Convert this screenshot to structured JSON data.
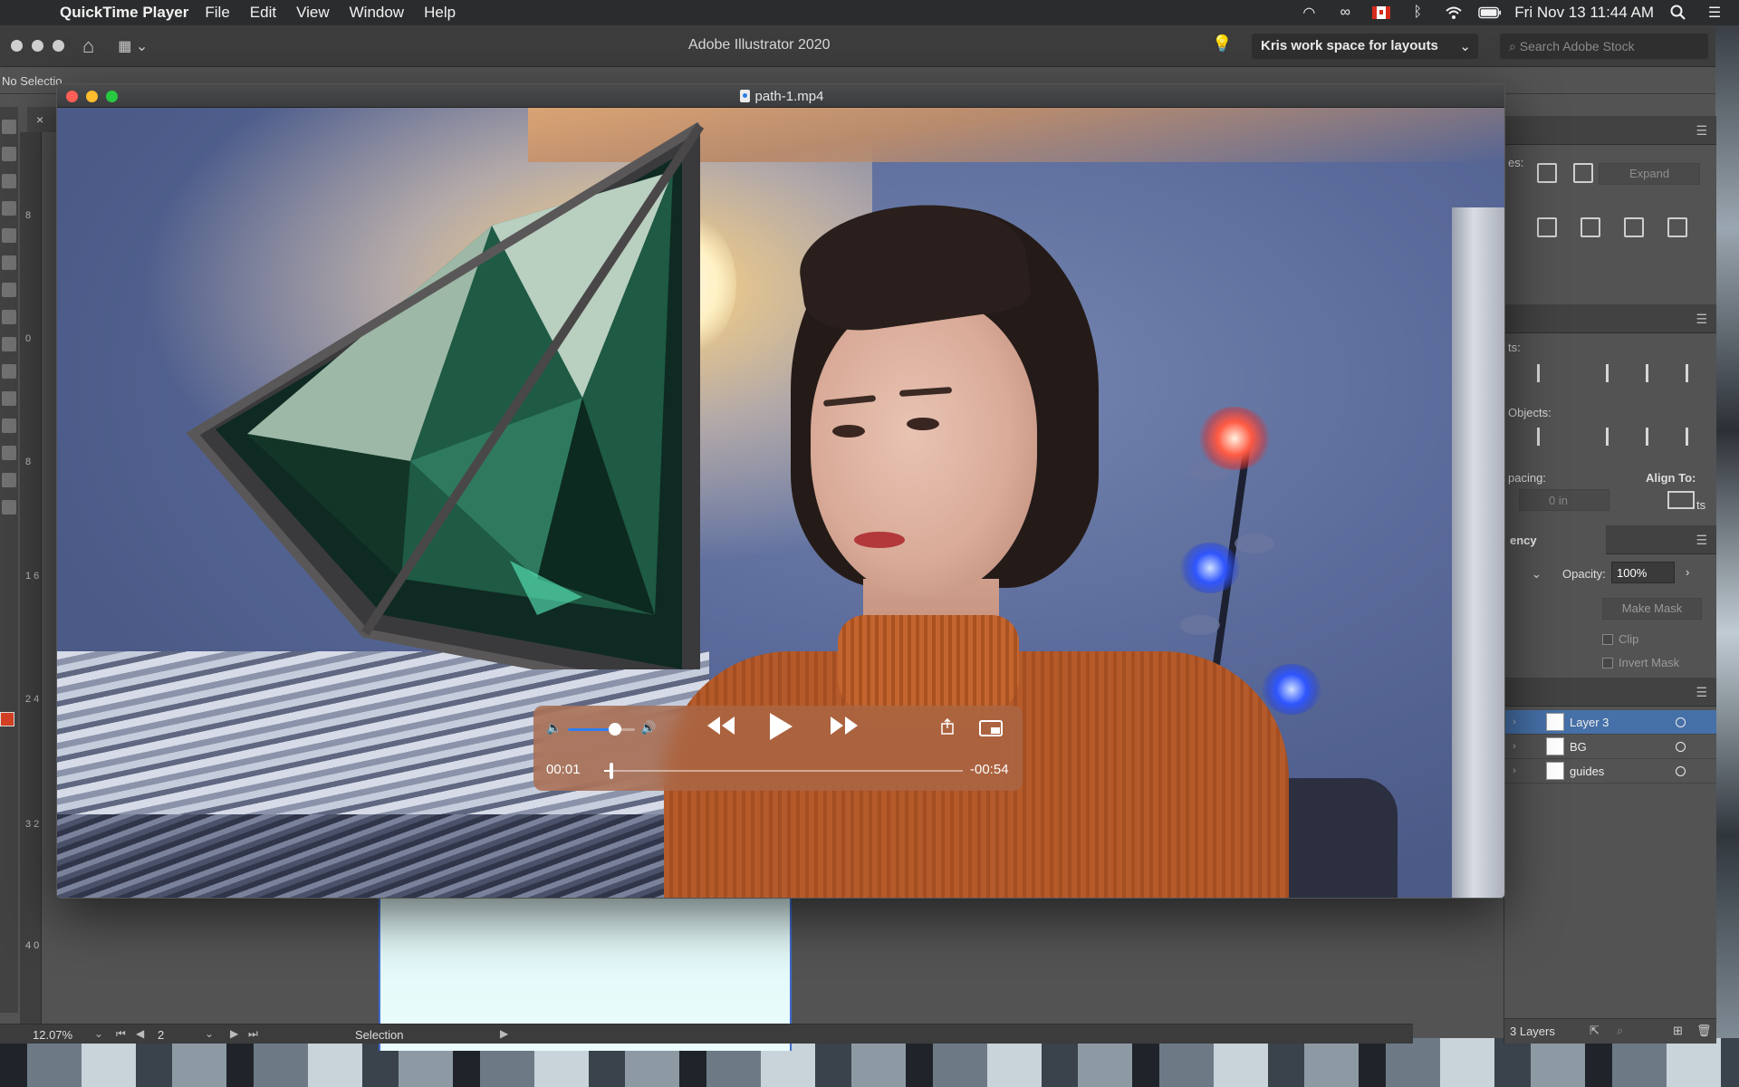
{
  "menubar": {
    "app_name": "QuickTime Player",
    "items": [
      "File",
      "Edit",
      "View",
      "Window",
      "Help"
    ],
    "datetime": "Fri Nov 13  11:44 AM"
  },
  "illustrator": {
    "title": "Adobe Illustrator 2020",
    "workspace": "Kris work space for layouts",
    "search_placeholder": "Search Adobe Stock",
    "control_bar_label": "No Selectio",
    "doc_tab_close": "×",
    "ruler_marks": [
      "8",
      "0",
      "8",
      "1 6",
      "2 4",
      "3 2",
      "4 0"
    ],
    "status": {
      "zoom": "12.07%",
      "page": "2",
      "tool": "Selection"
    },
    "pathfinder": {
      "shape_modes_label": "es:",
      "expand_label": "Expand"
    },
    "align": {
      "objects_label": "ts:",
      "distribute_label": "Objects:",
      "spacing_label": "pacing:",
      "align_to_label": "Align To:",
      "spacing_value": "0 in",
      "edge_text": "ts"
    },
    "transparency": {
      "tab_label": "ency",
      "opacity_label": "Opacity:",
      "opacity_value": "100%",
      "make_mask_label": "Make Mask",
      "clip_label": "Clip",
      "invert_mask_label": "Invert Mask"
    },
    "layers": {
      "items": [
        {
          "name": "Layer 3",
          "selected": true
        },
        {
          "name": "BG",
          "selected": false
        },
        {
          "name": "guides",
          "selected": false
        }
      ],
      "count_label": "3 Layers"
    }
  },
  "quicktime": {
    "title": "path-1.mp4",
    "time_current": "00:01",
    "time_remaining": "-00:54",
    "volume": 0.7,
    "progress": 0.02
  },
  "colors": {
    "accent_blue": "#2f7ff0",
    "layer_selection": "#4670a8",
    "close": "#fe5f57",
    "minimize": "#febc2e",
    "maximize": "#28c840"
  }
}
